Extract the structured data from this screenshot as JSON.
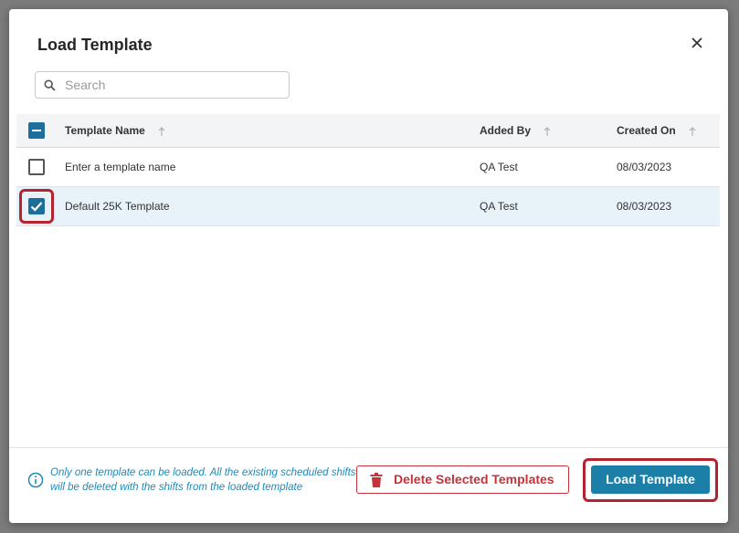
{
  "dialog": {
    "title": "Load Template"
  },
  "search": {
    "placeholder": "Search",
    "value": ""
  },
  "table": {
    "columns": [
      {
        "label": "Template Name",
        "sort_icon": "arrow-up-icon"
      },
      {
        "label": "Added By",
        "sort_icon": "arrow-up-icon"
      },
      {
        "label": "Created On",
        "sort_icon": "arrow-up-icon"
      }
    ],
    "header_checkbox_state": "indeterminate",
    "rows": [
      {
        "template_name": "Enter a template name",
        "added_by": "QA Test",
        "created_on": "08/03/2023",
        "checked": false
      },
      {
        "template_name": "Default 25K Template",
        "added_by": "QA Test",
        "created_on": "08/03/2023",
        "checked": true
      }
    ]
  },
  "footer": {
    "info_text": "Only one template can be loaded. All the existing scheduled shifts will be deleted with the shifts from the loaded template",
    "delete_label": "Delete Selected Templates",
    "load_label": "Load Template"
  },
  "colors": {
    "accent": "#1b7fa8",
    "checkbox": "#1b6f9a",
    "danger": "#c6313a",
    "highlight": "#b5232e",
    "info": "#1f8ab8",
    "selected_row": "#e8f3f9"
  }
}
